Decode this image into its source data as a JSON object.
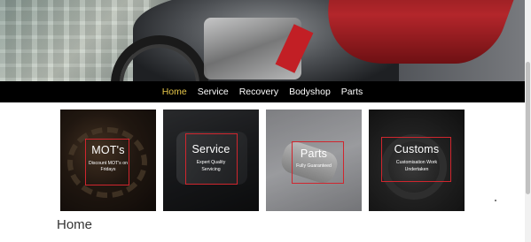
{
  "nav": {
    "items": [
      {
        "label": "Home",
        "active": true
      },
      {
        "label": "Service",
        "active": false
      },
      {
        "label": "Recovery",
        "active": false
      },
      {
        "label": "Bodyshop",
        "active": false
      },
      {
        "label": "Parts",
        "active": false
      }
    ],
    "active_color": "#e8c84a",
    "background": "#000000"
  },
  "cards": [
    {
      "title": "MOT's",
      "desc_line1": "Discount MOT's on",
      "desc_line2": "Fridays"
    },
    {
      "title": "Service",
      "desc_line1": "Expert Quality",
      "desc_line2": "Servicing"
    },
    {
      "title": "Parts",
      "desc_line1": "Fully Guaranteed",
      "desc_line2": ""
    },
    {
      "title": "Customs",
      "desc_line1": "Customisation Work",
      "desc_line2": "Undertaken"
    }
  ],
  "page": {
    "heading": "Home"
  },
  "colors": {
    "frame": "#d0262e"
  }
}
